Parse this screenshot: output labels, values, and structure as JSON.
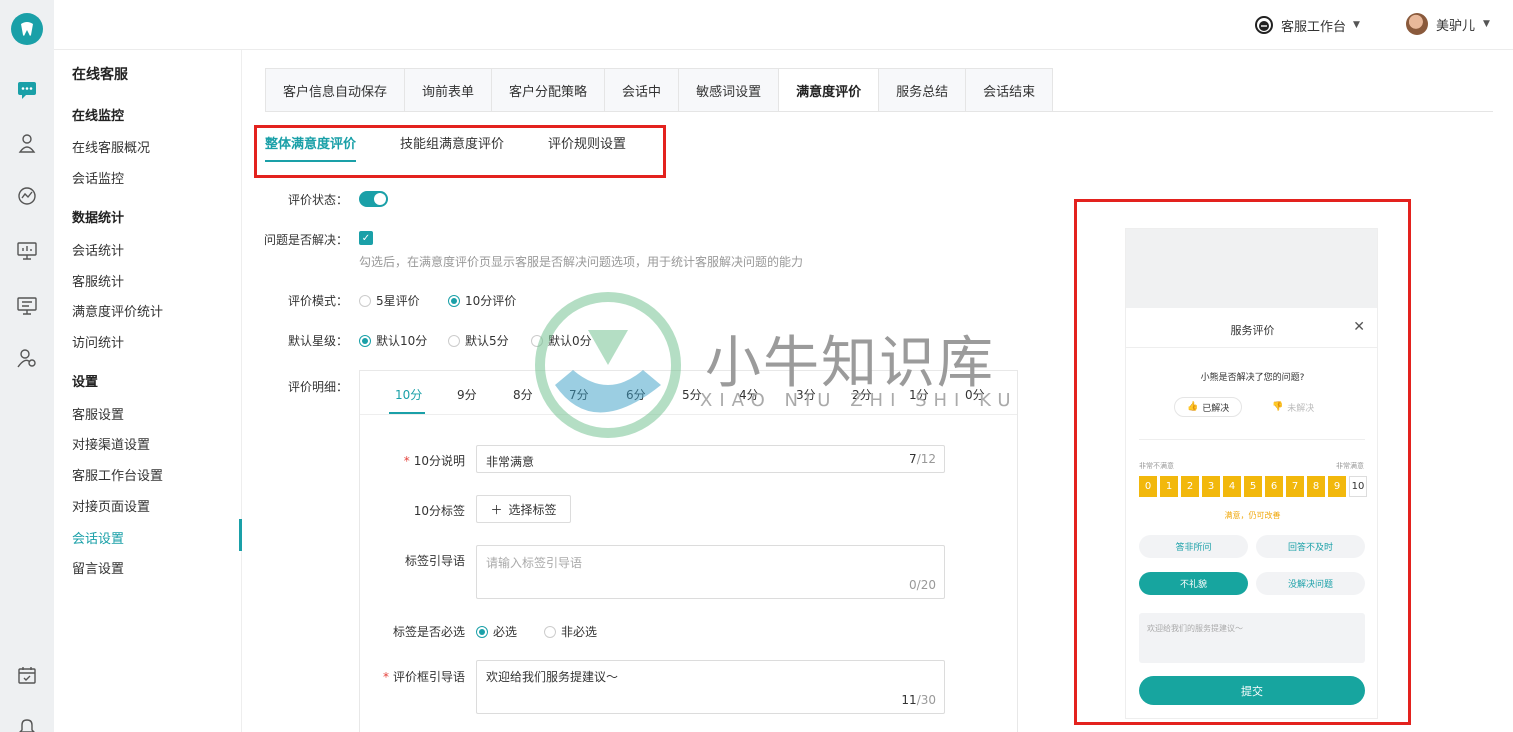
{
  "colors": {
    "accent": "#1aa0a8",
    "highlight_box": "#e3221e",
    "score_yellow": "#f2b80c"
  },
  "header": {
    "workspace_label": "客服工作台",
    "user_name": "美驴儿"
  },
  "sidebar": {
    "title": "在线客服",
    "groups": [
      {
        "label": "在线监控",
        "items": [
          "在线客服概况",
          "会话监控"
        ]
      },
      {
        "label": "数据统计",
        "items": [
          "会话统计",
          "客服统计",
          "满意度评价统计",
          "访问统计"
        ]
      },
      {
        "label": "设置",
        "items": [
          "客服设置",
          "对接渠道设置",
          "客服工作台设置",
          "对接页面设置",
          "会话设置",
          "留言设置"
        ]
      }
    ],
    "active_item": "会话设置"
  },
  "main_tabs": [
    "客户信息自动保存",
    "询前表单",
    "客户分配策略",
    "会话中",
    "敏感词设置",
    "满意度评价",
    "服务总结",
    "会话结束"
  ],
  "active_main_tab": "满意度评价",
  "sub_tabs": [
    "整体满意度评价",
    "技能组满意度评价",
    "评价规则设置"
  ],
  "active_sub_tab": "整体满意度评价",
  "form": {
    "status_label": "评价状态：",
    "status_on": true,
    "solved_label": "问题是否解决：",
    "solved_checked": true,
    "solved_hint": "勾选后，在满意度评价页显示客服是否解决问题选项，用于统计客服解决问题的能力",
    "mode_label": "评价模式：",
    "mode_options": [
      "5星评价",
      "10分评价"
    ],
    "mode_selected": "10分评价",
    "default_label": "默认星级：",
    "default_options": [
      "默认10分",
      "默认5分",
      "默认0分"
    ],
    "default_selected": "默认10分",
    "detail_label": "评价明细："
  },
  "detail": {
    "score_tabs": [
      "10分",
      "9分",
      "8分",
      "7分",
      "6分",
      "5分",
      "4分",
      "3分",
      "2分",
      "1分",
      "0分"
    ],
    "active_score": "10分",
    "desc_label": "10分说明",
    "desc_value": "非常满意",
    "desc_count": "7",
    "desc_max": "/12",
    "tag_label": "10分标签",
    "tag_button": "选择标签",
    "guide_label": "标签引导语",
    "guide_placeholder": "请输入标签引导语",
    "guide_count": "0/20",
    "required_label": "标签是否必选",
    "required_options": [
      "必选",
      "非必选"
    ],
    "required_selected": "必选",
    "box_guide_label": "评价框引导语",
    "box_guide_value": "欢迎给我们服务提建议～",
    "box_guide_count": "11",
    "box_guide_max": "/30"
  },
  "watermark": {
    "title": "小牛知识库",
    "subtitle": "XIAO NIU ZHI SHI KU"
  },
  "preview": {
    "title": "服务评价",
    "question": "小熊是否解决了您的问题?",
    "solved": "已解决",
    "unsolved": "未解决",
    "low_label": "非常不满意",
    "high_label": "非常满意",
    "scores": [
      "0",
      "1",
      "2",
      "3",
      "4",
      "5",
      "6",
      "7",
      "8",
      "9",
      "10"
    ],
    "note": "满意，仍可改善",
    "tags": [
      "答非所问",
      "回答不及时",
      "不礼貌",
      "没解决问题"
    ],
    "selected_tag": "不礼貌",
    "textarea_placeholder": "欢迎给我们的服务提建议～",
    "submit": "提交"
  }
}
